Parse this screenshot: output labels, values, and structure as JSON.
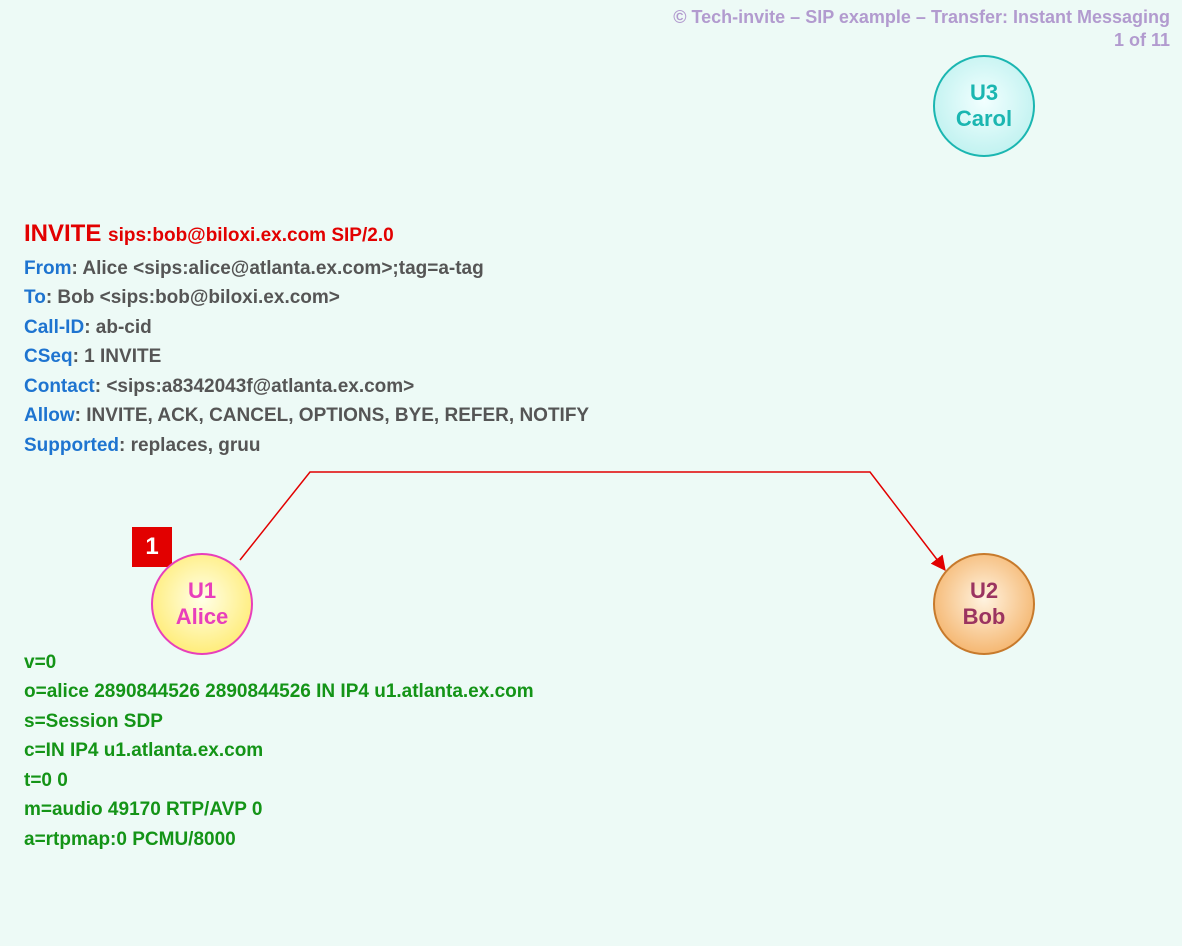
{
  "header": {
    "copyright": "© Tech-invite – SIP example – Transfer: Instant Messaging",
    "page": "1 of 11"
  },
  "sip": {
    "method": "INVITE",
    "request_line_rest": "sips:bob@biloxi.ex.com SIP/2.0",
    "from_key": "From",
    "from_val": ": Alice <sips:alice@atlanta.ex.com>;tag=a-tag",
    "to_key": "To",
    "to_val": ": Bob <sips:bob@biloxi.ex.com>",
    "callid_key": "Call-ID",
    "callid_val": ": ab-cid",
    "cseq_key": "CSeq",
    "cseq_val": ": 1 INVITE",
    "contact_key": "Contact",
    "contact_val": ": <sips:a8342043f@atlanta.ex.com>",
    "allow_key": "Allow",
    "allow_val": ": INVITE, ACK, CANCEL, OPTIONS, BYE, REFER, NOTIFY",
    "supported_key": "Supported",
    "supported_val": ": replaces, gruu"
  },
  "sdp": {
    "l1": "v=0",
    "l2": "o=alice  2890844526  2890844526  IN  IP4  u1.atlanta.ex.com",
    "l3": "s=Session SDP",
    "l4": "c=IN  IP4  u1.atlanta.ex.com",
    "l5": "t=0  0",
    "l6": "m=audio  49170  RTP/AVP  0",
    "l7": "a=rtpmap:0  PCMU/8000"
  },
  "step": {
    "number": "1"
  },
  "nodes": {
    "u1_id": "U1",
    "u1_name": "Alice",
    "u2_id": "U2",
    "u2_name": "Bob",
    "u3_id": "U3",
    "u3_name": "Carol"
  }
}
